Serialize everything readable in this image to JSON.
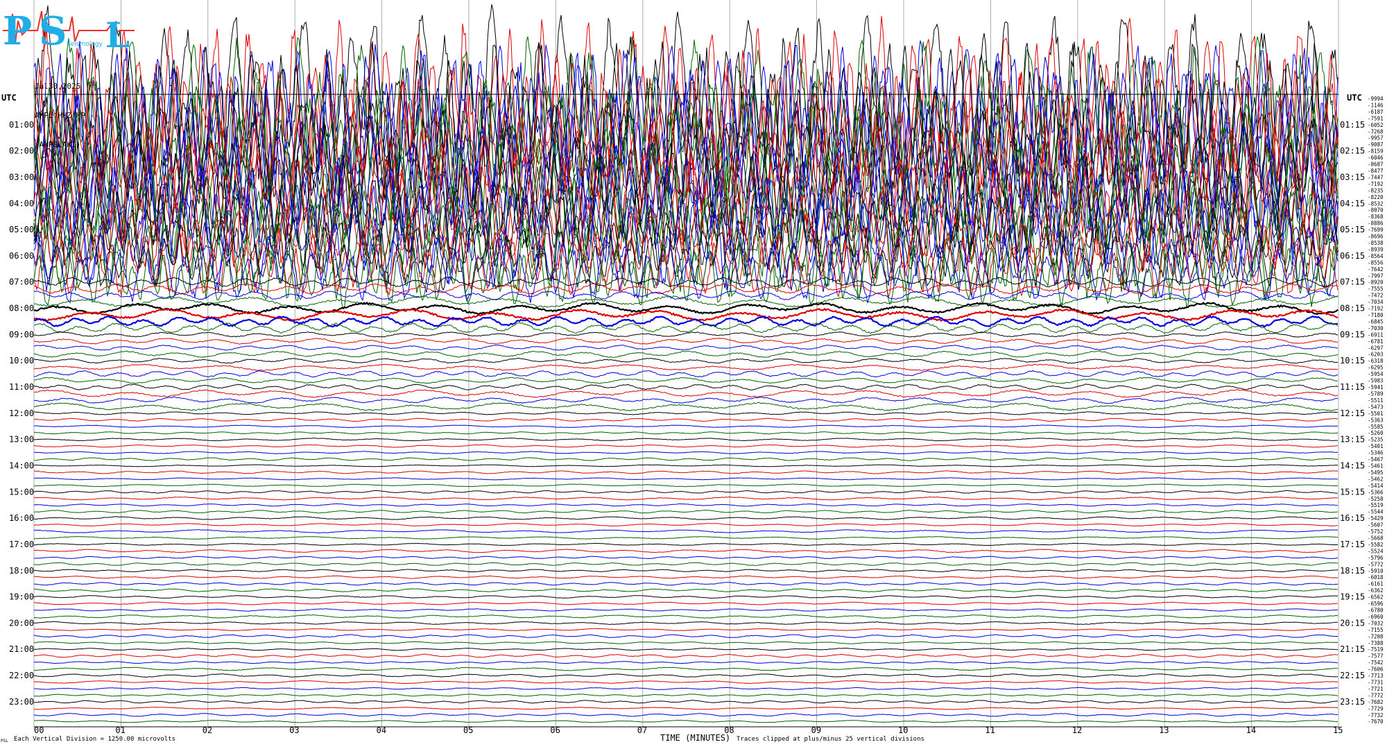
{
  "logo": {
    "letters": [
      "P",
      "S",
      "L"
    ],
    "tagline": "Seismology",
    "colors": {
      "letters": "#1faee8",
      "wave": "#e8312d"
    }
  },
  "header": {
    "date": "Jul30,2025",
    "channel": "AMPL HHZ HP --",
    "station": "(AMPELAKI)"
  },
  "footer": {
    "scale_note": "Each Vertical Division = 1250.00 microvolts",
    "clip_note": "Traces clipped at plus/minus 25 vertical divisions",
    "corner_mark": "PSL"
  },
  "chart_data": {
    "type": "line",
    "title": "",
    "xlabel": "TIME (MINUTES)",
    "ylabel": "UTC",
    "xlim": [
      0,
      15
    ],
    "x_ticks": [
      "00",
      "01",
      "02",
      "03",
      "04",
      "05",
      "06",
      "07",
      "08",
      "09",
      "10",
      "11",
      "12",
      "13",
      "14",
      "15"
    ],
    "left_axis_title": "UTC",
    "right_axis_title": "UTC",
    "left_hour_labels": [
      "01:00",
      "02:00",
      "03:00",
      "04:00",
      "05:00",
      "06:00",
      "07:00",
      "08:00",
      "09:00",
      "10:00",
      "11:00",
      "12:00",
      "13:00",
      "14:00",
      "15:00",
      "16:00",
      "17:00",
      "18:00",
      "19:00",
      "20:00",
      "21:00",
      "22:00",
      "23:00"
    ],
    "right_hour_labels": [
      "01:15",
      "02:15",
      "03:15",
      "04:15",
      "05:15",
      "06:15",
      "07:15",
      "08:15",
      "09:15",
      "10:15",
      "11:15",
      "12:15",
      "13:15",
      "14:15",
      "15:15",
      "16:15",
      "17:15",
      "18:15",
      "19:15",
      "20:15",
      "21:15",
      "22:15",
      "23:15"
    ],
    "trace_count": 96,
    "trace_minutes": 15,
    "trace_colors": [
      "#000000",
      "#e00000",
      "#0000e0",
      "#006400"
    ],
    "trace_offsets": [
      -9994,
      -1146,
      -6187,
      -7591,
      -6052,
      -7268,
      -9957,
      -9087,
      -8159,
      -6046,
      -8687,
      -8477,
      -7447,
      -7192,
      -8235,
      -8220,
      -8532,
      -8070,
      -8368,
      -8886,
      -7699,
      -8696,
      -8538,
      -8939,
      -8564,
      -8556,
      -7642,
      -7997,
      -8920,
      -7555,
      -7472,
      -7034,
      -7192,
      -7180,
      -6845,
      -7030,
      -6911,
      -6781,
      -6297,
      -6203,
      -6318,
      -6295,
      -5954,
      -5983,
      -5941,
      -5789,
      -5511,
      -5473,
      -5501,
      -5363,
      -5585,
      -5260,
      -5235,
      -5401,
      -5346,
      -5467,
      -5461,
      -5495,
      -5462,
      -5414,
      -5366,
      -5258,
      -5519,
      -5544,
      -5429,
      -5607,
      -5752,
      -5668,
      -5582,
      -5524,
      -5796,
      -5772,
      -5910,
      -6018,
      -6161,
      -6362,
      -6562,
      -6596,
      -6780,
      -6960,
      -7032,
      -7155,
      -7208,
      -7388,
      -7519,
      -7577,
      -7542,
      -7606,
      -7713,
      -7731,
      -7721,
      -7772,
      -7682,
      -7729,
      -7732,
      -7670
    ],
    "activity_profile": [
      {
        "from_hour": 0,
        "to_hour": 7,
        "level": "saturated"
      },
      {
        "from_hour": 7,
        "to_hour": 9,
        "level": "strong-microseism"
      },
      {
        "from_hour": 9,
        "to_hour": 12,
        "level": "moderate"
      },
      {
        "from_hour": 12,
        "to_hour": 24,
        "level": "quiet"
      }
    ],
    "clip_divisions": 25,
    "division_microvolts": 1250.0,
    "grid": true
  }
}
